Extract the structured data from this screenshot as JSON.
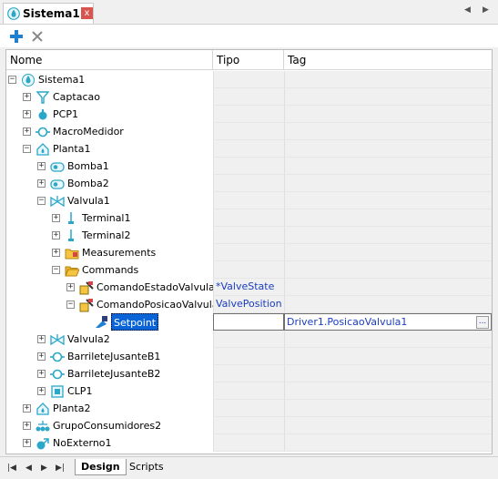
{
  "window": {
    "tab_title": "Sistema1",
    "close_glyph": "x",
    "nav_left": "◀",
    "nav_right": "▶"
  },
  "toolbar": {
    "add_icon": "plus-icon",
    "delete_icon": "x-icon"
  },
  "columns": {
    "name": "Nome",
    "type": "Tipo",
    "tag": "Tag"
  },
  "rows": [
    {
      "label": "Sistema1",
      "icon": "system-drop-icon",
      "expander": "−",
      "tipo": "",
      "tag": ""
    },
    {
      "label": "Captacao",
      "icon": "intake-funnel-icon",
      "expander": "+",
      "tipo": "",
      "tag": ""
    },
    {
      "label": "PCP1",
      "icon": "pcp-node-icon",
      "expander": "+",
      "tipo": "",
      "tag": ""
    },
    {
      "label": "MacroMedidor",
      "icon": "meter-icon",
      "expander": "+",
      "tipo": "",
      "tag": ""
    },
    {
      "label": "Planta1",
      "icon": "plant-house-icon",
      "expander": "−",
      "tipo": "",
      "tag": ""
    },
    {
      "label": "Bomba1",
      "icon": "pump-icon",
      "expander": "+",
      "tipo": "",
      "tag": ""
    },
    {
      "label": "Bomba2",
      "icon": "pump-icon",
      "expander": "+",
      "tipo": "",
      "tag": ""
    },
    {
      "label": "Valvula1",
      "icon": "valve-icon",
      "expander": "−",
      "tipo": "",
      "tag": ""
    },
    {
      "label": "Terminal1",
      "icon": "terminal-icon",
      "expander": "+",
      "tipo": "",
      "tag": ""
    },
    {
      "label": "Terminal2",
      "icon": "terminal-icon",
      "expander": "+",
      "tipo": "",
      "tag": ""
    },
    {
      "label": "Measurements",
      "icon": "folder-measure-icon",
      "expander": "+",
      "tipo": "",
      "tag": ""
    },
    {
      "label": "Commands",
      "icon": "folder-open-icon",
      "expander": "−",
      "tipo": "",
      "tag": ""
    },
    {
      "label": "ComandoEstadoValvula",
      "icon": "command-icon",
      "expander": "+",
      "tipo": "*ValveState",
      "tag": ""
    },
    {
      "label": "ComandoPosicaoValvula",
      "icon": "command-icon",
      "expander": "−",
      "tipo": "ValvePosition",
      "tag": ""
    },
    {
      "label": "Setpoint",
      "icon": "setpoint-icon",
      "expander": "",
      "tipo": "",
      "tag": "Driver1.PosicaoValvula1",
      "selected": true,
      "ellipsis": "..."
    },
    {
      "label": "Valvula2",
      "icon": "valve-icon",
      "expander": "+",
      "tipo": "",
      "tag": ""
    },
    {
      "label": "BarrileteJusanteB1",
      "icon": "meter-icon",
      "expander": "+",
      "tipo": "",
      "tag": ""
    },
    {
      "label": "BarrileteJusanteB2",
      "icon": "meter-icon",
      "expander": "+",
      "tipo": "",
      "tag": ""
    },
    {
      "label": "CLP1",
      "icon": "clp-icon",
      "expander": "+",
      "tipo": "",
      "tag": ""
    },
    {
      "label": "Planta2",
      "icon": "plant-house-icon",
      "expander": "+",
      "tipo": "",
      "tag": ""
    },
    {
      "label": "GrupoConsumidores2",
      "icon": "consumer-group-icon",
      "expander": "+",
      "tipo": "",
      "tag": ""
    },
    {
      "label": "NoExterno1",
      "icon": "external-node-icon",
      "expander": "+",
      "tipo": "",
      "tag": ""
    }
  ],
  "bottom_tabs": {
    "design": "Design",
    "scripts": "Scripts"
  },
  "colors": {
    "accent": "#0a64d8",
    "link_text": "#1a3dc0",
    "icon_teal": "#2aa7c9"
  }
}
